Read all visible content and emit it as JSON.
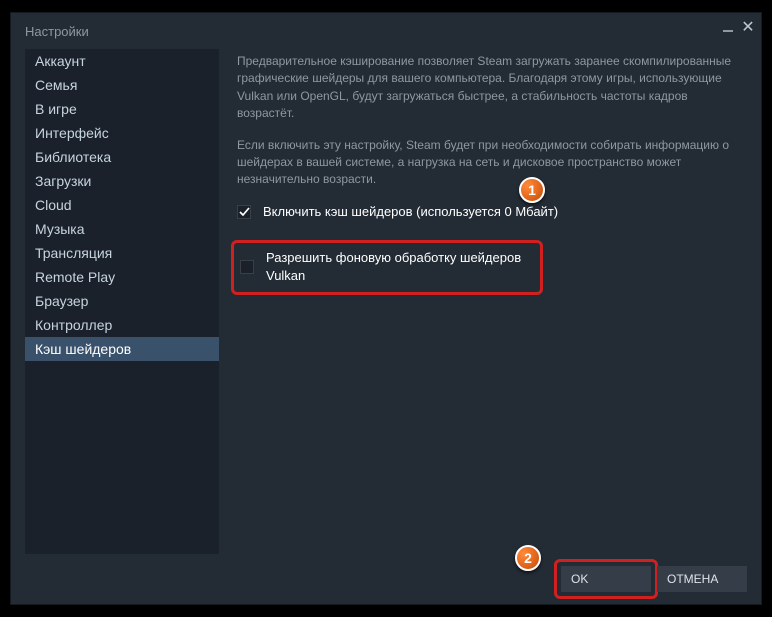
{
  "window": {
    "title": "Настройки"
  },
  "sidebar": {
    "items": [
      {
        "label": "Аккаунт"
      },
      {
        "label": "Семья"
      },
      {
        "label": "В игре"
      },
      {
        "label": "Интерфейс"
      },
      {
        "label": "Библиотека"
      },
      {
        "label": "Загрузки"
      },
      {
        "label": "Cloud"
      },
      {
        "label": "Музыка"
      },
      {
        "label": "Трансляция"
      },
      {
        "label": "Remote Play"
      },
      {
        "label": "Браузер"
      },
      {
        "label": "Контроллер"
      },
      {
        "label": "Кэш шейдеров"
      }
    ],
    "selected_index": 12
  },
  "content": {
    "para1": "Предварительное кэширование позволяет Steam загружать заранее скомпилированные графические шейдеры для вашего компьютера. Благодаря этому игры, использующие Vulkan или OpenGL, будут загружаться быстрее, а стабильность частоты кадров возрастёт.",
    "para2": "Если включить эту настройку, Steam будет при необходимости собирать информацию о шейдерах в вашей системе, а нагрузка на сеть и дисковое пространство может незначительно возрасти.",
    "option1": {
      "label": "Включить кэш шейдеров (используется 0 Мбайт)",
      "checked": true
    },
    "option2": {
      "label": "Разрешить фоновую обработку шейдеров Vulkan",
      "checked": false
    }
  },
  "footer": {
    "ok": "OK",
    "cancel": "ОТМЕНА"
  },
  "callouts": {
    "c1": "1",
    "c2": "2"
  }
}
